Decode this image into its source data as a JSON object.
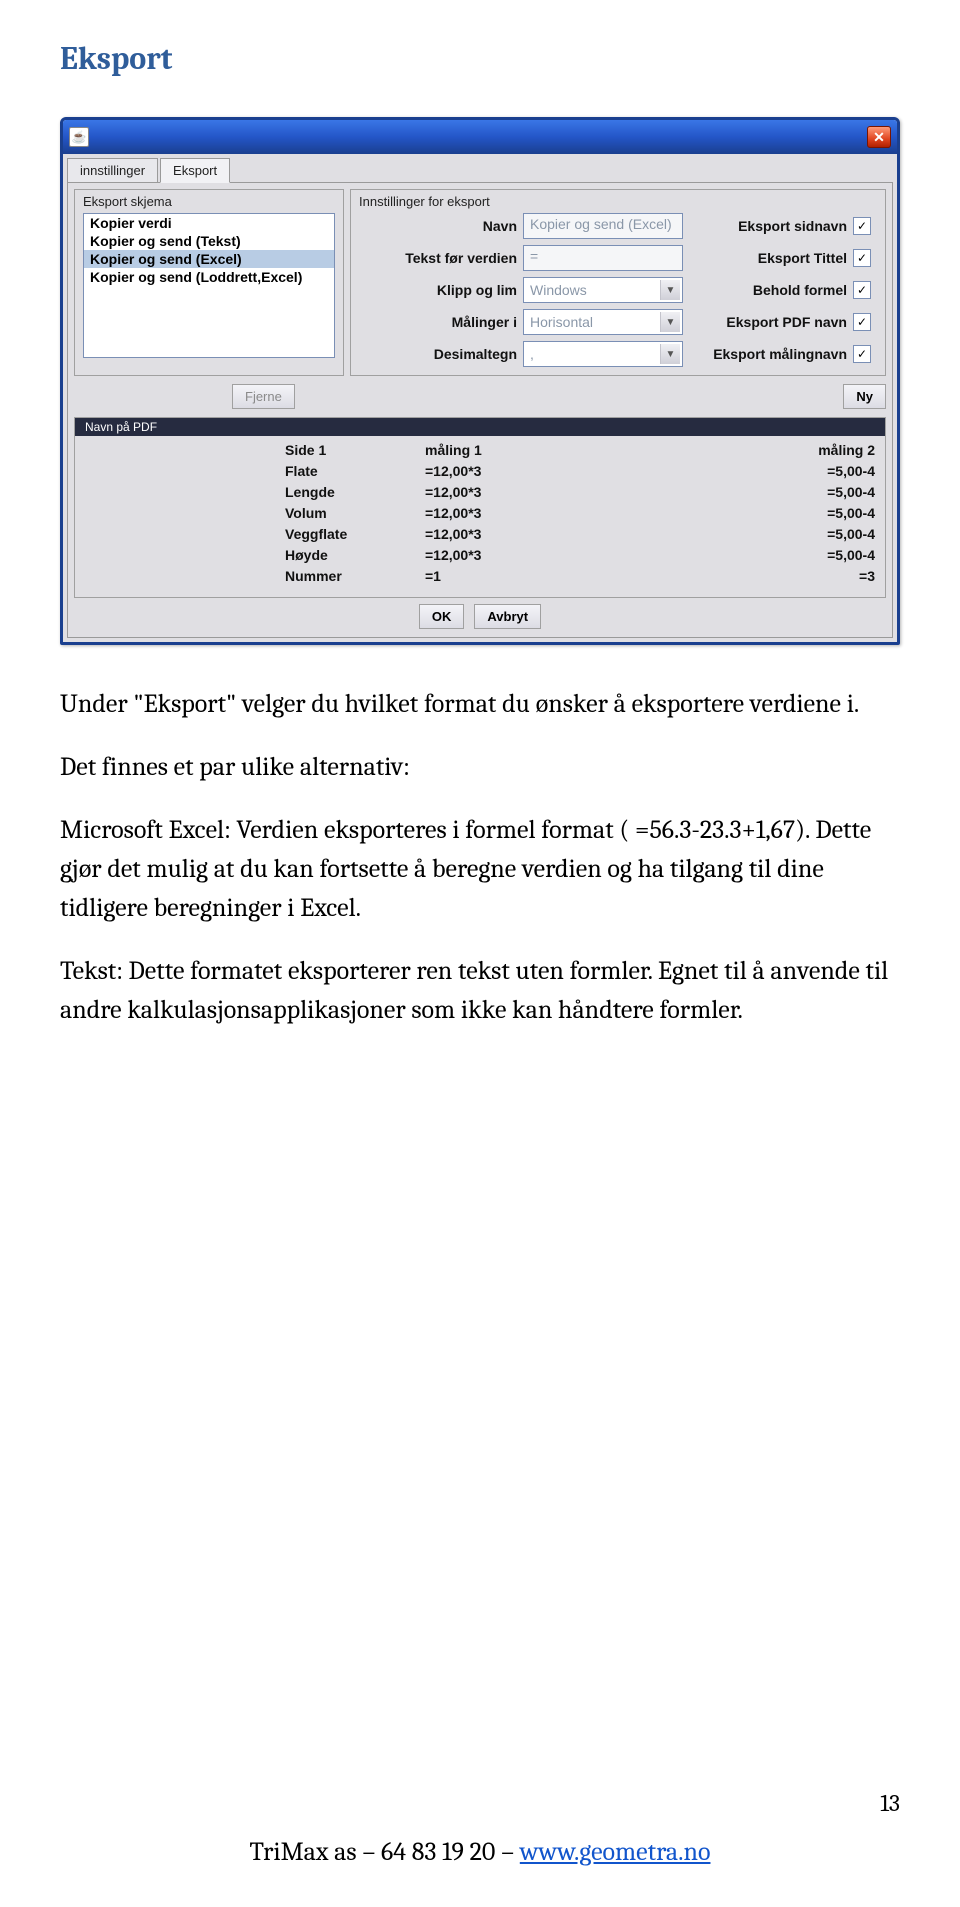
{
  "page": {
    "title": "Eksport",
    "page_number": "13",
    "footer_prefix": "TriMax as – 64 83 19 20 – ",
    "footer_link": "www.geometra.no"
  },
  "win": {
    "tabs": [
      "innstillinger",
      "Eksport"
    ],
    "active_tab": 1,
    "left_group_title": "Eksport skjema",
    "right_group_title": "Innstillinger for eksport",
    "list_items": [
      "Kopier verdi",
      "Kopier og send (Tekst)",
      "Kopier og send (Excel)",
      "Kopier og send (Loddrett,Excel)"
    ],
    "selected_item_index": 2,
    "labels": {
      "navn": "Navn",
      "tekst_for": "Tekst før verdien",
      "klipp": "Klipp og lim",
      "malinger": "Målinger i",
      "desimal": "Desimaltegn",
      "sidnavn": "Eksport sidnavn",
      "tittel": "Eksport Tittel",
      "formel": "Behold formel",
      "pdfnavn": "Eksport PDF navn",
      "malingnavn": "Eksport målingnavn"
    },
    "values": {
      "navn": "Kopier og send (Excel)",
      "tekst_for": "=",
      "klipp": "Windows",
      "malinger": "Horisontal",
      "desimal": ","
    },
    "checks": {
      "sidnavn": true,
      "tittel": true,
      "formel": true,
      "pdfnavn": true,
      "malingnavn": true
    },
    "btn_fjerne": "Fjerne",
    "btn_ny": "Ny",
    "strip": "Navn på PDF",
    "table": {
      "h1": "Side 1",
      "h2": "måling 1",
      "h3": "måling 2",
      "rows": [
        {
          "a": "Flate",
          "b": "=12,00*3",
          "c": "=5,00-4"
        },
        {
          "a": "Lengde",
          "b": "=12,00*3",
          "c": "=5,00-4"
        },
        {
          "a": "Volum",
          "b": "=12,00*3",
          "c": "=5,00-4"
        },
        {
          "a": "Veggflate",
          "b": "=12,00*3",
          "c": "=5,00-4"
        },
        {
          "a": "Høyde",
          "b": "=12,00*3",
          "c": "=5,00-4"
        },
        {
          "a": "Nummer",
          "b": "=1",
          "c": "=3"
        }
      ]
    },
    "btn_ok": "OK",
    "btn_avbryt": "Avbryt"
  },
  "body": {
    "p1": "Under \"Eksport\" velger du hvilket format du ønsker å eksportere verdiene i.",
    "p2": "Det finnes et par ulike alternativ:",
    "p3": "Microsoft Excel: Verdien eksporteres i formel format ( =56.3-23.3+1,67). Dette gjør det mulig at du kan fortsette å beregne verdien og ha tilgang til dine tidligere beregninger i Excel.",
    "p4": "Tekst: Dette formatet eksporterer ren tekst uten formler. Egnet til å anvende til andre kalkulasjonsapplikasjoner som ikke kan håndtere formler."
  }
}
